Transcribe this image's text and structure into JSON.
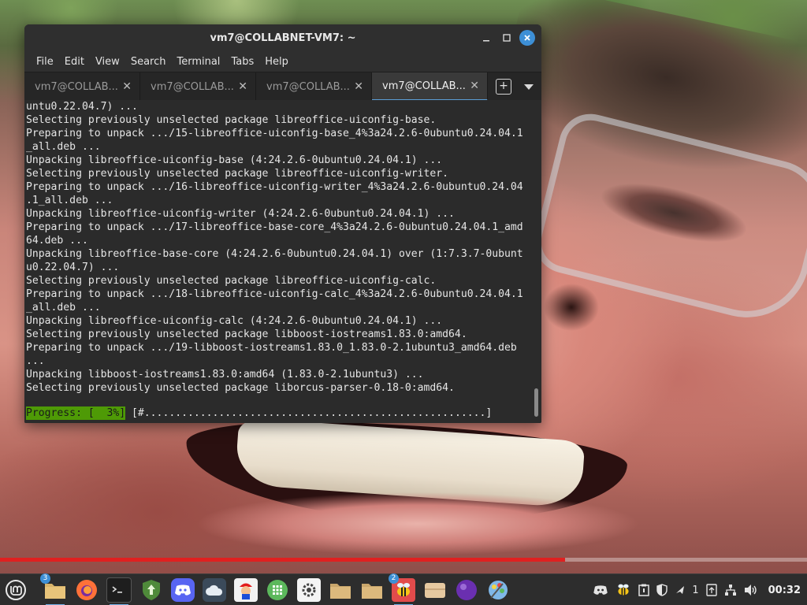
{
  "window": {
    "title": "vm7@COLLABNET-VM7: ~",
    "minimize_glyph": "🗕",
    "maximize_glyph": "☐",
    "close_glyph": "✕"
  },
  "menu": [
    "File",
    "Edit",
    "View",
    "Search",
    "Terminal",
    "Tabs",
    "Help"
  ],
  "tabs": [
    {
      "label": "vm7@COLLAB...",
      "active": false
    },
    {
      "label": "vm7@COLLAB...",
      "active": false
    },
    {
      "label": "vm7@COLLAB...",
      "active": false
    },
    {
      "label": "vm7@COLLAB...",
      "active": true
    }
  ],
  "tab_close_glyph": "✕",
  "new_tab_glyph": "+",
  "terminal_lines": [
    "untu0.22.04.7) ...",
    "Selecting previously unselected package libreoffice-uiconfig-base.",
    "Preparing to unpack .../15-libreoffice-uiconfig-base_4%3a24.2.6-0ubuntu0.24.04.1",
    "_all.deb ...",
    "Unpacking libreoffice-uiconfig-base (4:24.2.6-0ubuntu0.24.04.1) ...",
    "Selecting previously unselected package libreoffice-uiconfig-writer.",
    "Preparing to unpack .../16-libreoffice-uiconfig-writer_4%3a24.2.6-0ubuntu0.24.04",
    ".1_all.deb ...",
    "Unpacking libreoffice-uiconfig-writer (4:24.2.6-0ubuntu0.24.04.1) ...",
    "Preparing to unpack .../17-libreoffice-base-core_4%3a24.2.6-0ubuntu0.24.04.1_amd",
    "64.deb ...",
    "Unpacking libreoffice-base-core (4:24.2.6-0ubuntu0.24.04.1) over (1:7.3.7-0ubunt",
    "u0.22.04.7) ...",
    "Selecting previously unselected package libreoffice-uiconfig-calc.",
    "Preparing to unpack .../18-libreoffice-uiconfig-calc_4%3a24.2.6-0ubuntu0.24.04.1",
    "_all.deb ...",
    "Unpacking libreoffice-uiconfig-calc (4:24.2.6-0ubuntu0.24.04.1) ...",
    "Selecting previously unselected package libboost-iostreams1.83.0:amd64.",
    "Preparing to unpack .../19-libboost-iostreams1.83.0_1.83.0-2.1ubuntu3_amd64.deb",
    "...",
    "Unpacking libboost-iostreams1.83.0:amd64 (1.83.0-2.1ubuntu3) ...",
    "Selecting previously unselected package liborcus-parser-0.18-0:amd64."
  ],
  "progress": {
    "label": "Progress: [  3%]",
    "bar": " [#.......................................................]",
    "percent": 3
  },
  "taskbar": {
    "apps": [
      {
        "name": "files",
        "badge": "3",
        "running": true
      },
      {
        "name": "firefox",
        "badge": "",
        "running": false
      },
      {
        "name": "terminal",
        "badge": "",
        "running": true
      },
      {
        "name": "update-manager",
        "badge": "",
        "running": false
      },
      {
        "name": "discord",
        "badge": "",
        "running": false
      },
      {
        "name": "cloud",
        "badge": "",
        "running": false
      },
      {
        "name": "mario-game",
        "badge": "",
        "running": false
      },
      {
        "name": "grid-app",
        "badge": "",
        "running": false
      },
      {
        "name": "settings",
        "badge": "",
        "running": false
      },
      {
        "name": "folder",
        "badge": "",
        "running": false
      },
      {
        "name": "folder",
        "badge": "",
        "running": false
      },
      {
        "name": "bee-app",
        "badge": "2",
        "running": true
      },
      {
        "name": "archive",
        "badge": "",
        "running": false
      },
      {
        "name": "purple-app",
        "badge": "",
        "running": false
      },
      {
        "name": "paint-app",
        "badge": "",
        "running": false
      }
    ],
    "tray": {
      "notification_count": "1",
      "clock": "00:32"
    }
  },
  "video_progress": 0.7,
  "colors": {
    "accent": "#3d8fd6",
    "progress_green": "#4e9a06",
    "video_red": "#e02020"
  }
}
